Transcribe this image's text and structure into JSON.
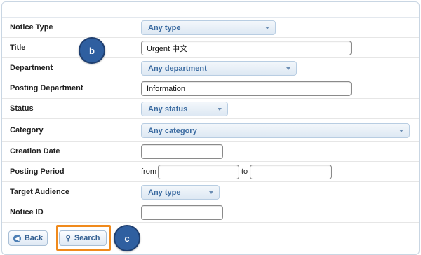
{
  "form": {
    "notice_type": {
      "label": "Notice Type",
      "value": "Any type"
    },
    "title": {
      "label": "Title",
      "value": "Urgent 中文"
    },
    "department": {
      "label": "Department",
      "value": "Any department"
    },
    "posting_department": {
      "label": "Posting Department",
      "value": "Information"
    },
    "status": {
      "label": "Status",
      "value": "Any status"
    },
    "category": {
      "label": "Category",
      "value": "Any category"
    },
    "creation_date": {
      "label": "Creation Date",
      "value": ""
    },
    "posting_period": {
      "label": "Posting Period",
      "from_label": "from",
      "to_label": "to",
      "from_value": "",
      "to_value": ""
    },
    "target_audience": {
      "label": "Target Audience",
      "value": "Any type"
    },
    "notice_id": {
      "label": "Notice ID",
      "value": ""
    }
  },
  "buttons": {
    "back": "Back",
    "search": "Search"
  },
  "markers": {
    "b": "b",
    "c": "c"
  },
  "colors": {
    "highlight": "#f08a1c",
    "marker": "#2f5fa0",
    "select_text": "#3a6aa0"
  },
  "icons": {
    "back": "circle-arrow-left-icon",
    "search": "magnifier-icon",
    "dropdown": "chevron-down-icon"
  }
}
